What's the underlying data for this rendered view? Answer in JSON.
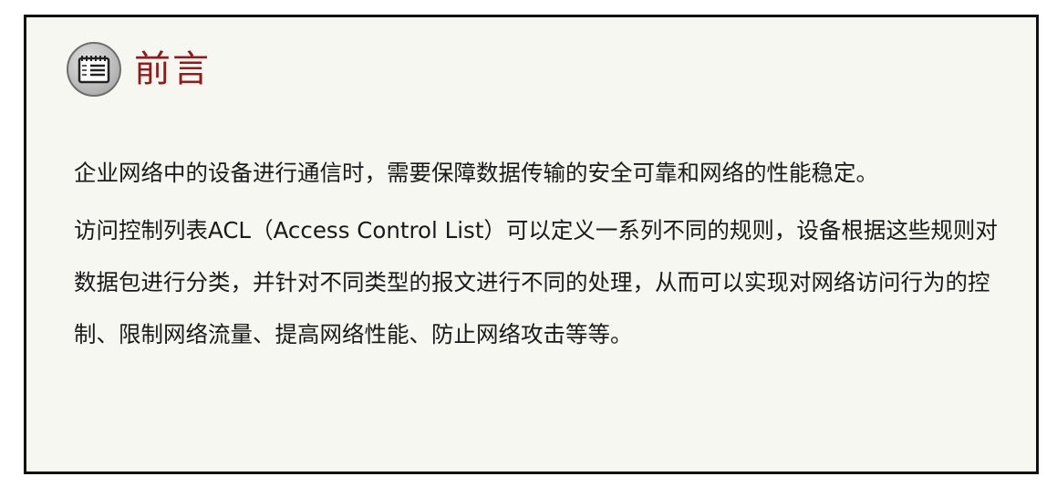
{
  "header": {
    "icon": "notepad-icon",
    "title": "前言"
  },
  "content": {
    "paragraphs": [
      "企业网络中的设备进行通信时，需要保障数据传输的安全可靠和网络的性能稳定。",
      "访问控制列表ACL（Access Control List）可以定义一系列不同的规则，设备根据这些规则对数据包进行分类，并针对不同类型的报文进行不同的处理，从而可以实现对网络访问行为的控制、限制网络流量、提高网络性能、防止网络攻击等等。"
    ]
  },
  "colors": {
    "title": "#8f1c1c",
    "background": "#f7f7f2",
    "border": "#111111"
  }
}
